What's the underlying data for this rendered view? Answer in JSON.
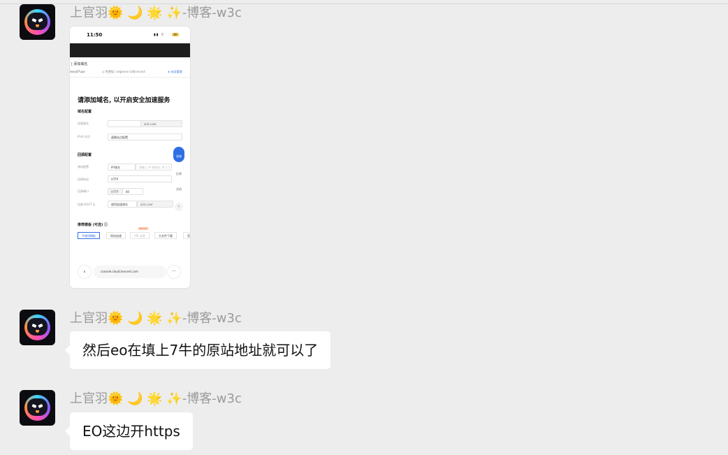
{
  "messages": [
    {
      "sender": "上官羽🌞 🌙 🌟 ✨-博客-w3c",
      "type": "image",
      "screenshot": {
        "time": "11:50",
        "signal": "▮▮ ⌔",
        "battery": "80",
        "breadcrumb": "|  添加域名",
        "site_id": "iwey87vpe",
        "path": "◎ 免费版 | edgeone-3dfjnnrcw4",
        "path_action": "⊕ 站点管理",
        "heading": "请添加域名, 以开启安全加速服务",
        "domain_section": "域名配置",
        "domain_label": "加速域名",
        "domain_value": "w3c.cool",
        "ipv6_label": "IPv6 访问",
        "ipv6_value": "遵循站点配置",
        "origin_section": "回源配置",
        "origin_type_label": "源站配置",
        "origin_type_value": "IP/域名",
        "origin_placeholder": "请输入 IP 或域名, 如 1.1.1.1",
        "protocol_label": "回源协议",
        "protocol_value": "HTTP",
        "port_label": "回源端口",
        "port_proto": "HTTP",
        "port_value": "80",
        "host_label": "回源 HOST 头",
        "host_mode": "使用加速域名",
        "host_value": "w3c.cool",
        "fab_label": "咨询",
        "side_btn1": "反馈",
        "side_btn2": "文档",
        "template_section": "推荐模板 (可选) ⓘ",
        "badge": "推荐使用",
        "tags": [
          "不使用模板",
          "网站加速",
          "API 加速",
          "大文件下载",
          "音"
        ],
        "url": "console.cloud.tencent.com"
      }
    },
    {
      "sender": "上官羽🌞 🌙 🌟 ✨-博客-w3c",
      "type": "text",
      "text": "然后eo在填上7牛的原站地址就可以了"
    },
    {
      "sender": "上官羽🌞 🌙 🌟 ✨-博客-w3c",
      "type": "text",
      "text": "EO这边开https"
    }
  ]
}
